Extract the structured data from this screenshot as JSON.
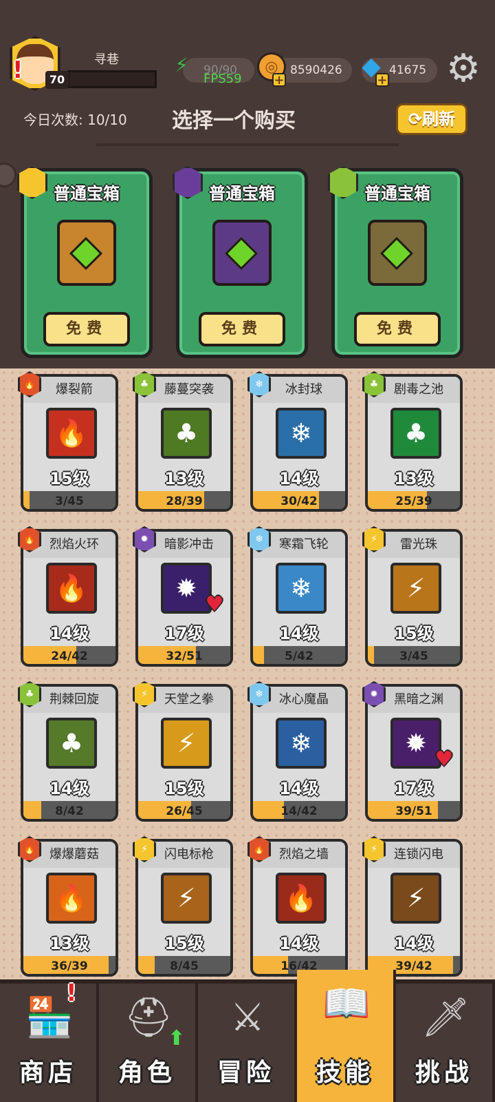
{
  "player": {
    "name": "寻巷",
    "level": "70"
  },
  "resources": {
    "energy": "90/90",
    "fps": "FPS59",
    "coins": "8590426",
    "gems": "41675"
  },
  "header": {
    "daily_count": "今日次数: 10/10",
    "title": "选择一个购买",
    "refresh_label": "刷新"
  },
  "chests": [
    {
      "title": "普通宝箱",
      "button": "免费",
      "element": "lightning",
      "elem_color": "#f6c52e",
      "body_color": "#c9842e"
    },
    {
      "title": "普通宝箱",
      "button": "免费",
      "element": "shadow",
      "elem_color": "#6a3d9a",
      "body_color": "#5d3a86"
    },
    {
      "title": "普通宝箱",
      "button": "免费",
      "element": "nature",
      "elem_color": "#8ac23a",
      "body_color": "#7b6a3a"
    }
  ],
  "skills": [
    {
      "name": "爆裂箭",
      "level": "15级",
      "progress": "3/45",
      "element": "fire",
      "color": "#e0522a",
      "icon_bg": "#c5301f"
    },
    {
      "name": "藤蔓突袭",
      "level": "13级",
      "progress": "28/39",
      "element": "nature",
      "color": "#8ac23a",
      "icon_bg": "#4d7a22"
    },
    {
      "name": "冰封球",
      "level": "14级",
      "progress": "30/42",
      "element": "ice",
      "color": "#7ec8f0",
      "icon_bg": "#2a6fa8"
    },
    {
      "name": "剧毒之池",
      "level": "13级",
      "progress": "25/39",
      "element": "nature",
      "color": "#8ac23a",
      "icon_bg": "#1f8a3a"
    },
    {
      "name": "烈焰火环",
      "level": "14级",
      "progress": "24/42",
      "element": "fire",
      "color": "#e0522a",
      "icon_bg": "#a82a1a"
    },
    {
      "name": "暗影冲击",
      "level": "17级",
      "progress": "32/51",
      "element": "shadow",
      "color": "#7a4fb0",
      "icon_bg": "#3a1f6a",
      "favorite": true
    },
    {
      "name": "寒霜飞轮",
      "level": "14级",
      "progress": "5/42",
      "element": "ice",
      "color": "#7ec8f0",
      "icon_bg": "#3a88c8"
    },
    {
      "name": "雷光珠",
      "level": "15级",
      "progress": "3/45",
      "element": "lightning",
      "color": "#f6c52e",
      "icon_bg": "#b8751a"
    },
    {
      "name": "荆棘回旋",
      "level": "14级",
      "progress": "8/42",
      "element": "nature",
      "color": "#8ac23a",
      "icon_bg": "#557a2a"
    },
    {
      "name": "天堂之拳",
      "level": "15级",
      "progress": "26/45",
      "element": "lightning",
      "color": "#f6c52e",
      "icon_bg": "#d89a1a"
    },
    {
      "name": "冰心魔晶",
      "level": "14级",
      "progress": "14/42",
      "element": "ice",
      "color": "#7ec8f0",
      "icon_bg": "#2a5fa0"
    },
    {
      "name": "黑暗之渊",
      "level": "17级",
      "progress": "39/51",
      "element": "shadow",
      "color": "#7a4fb0",
      "icon_bg": "#4a1f6a",
      "favorite": true
    },
    {
      "name": "爆爆蘑菇",
      "level": "13级",
      "progress": "36/39",
      "element": "fire",
      "color": "#e0522a",
      "icon_bg": "#d8641a"
    },
    {
      "name": "闪电标枪",
      "level": "15级",
      "progress": "8/45",
      "element": "lightning",
      "color": "#f6c52e",
      "icon_bg": "#a8641a"
    },
    {
      "name": "烈焰之墙",
      "level": "14级",
      "progress": "16/42",
      "element": "fire",
      "color": "#e0522a",
      "icon_bg": "#9a2a1a"
    },
    {
      "name": "连锁闪电",
      "level": "14级",
      "progress": "39/42",
      "element": "lightning",
      "color": "#f6c52e",
      "icon_bg": "#7a4a1a"
    }
  ],
  "nav": [
    {
      "label": "商店",
      "icon": "shop-icon",
      "alert": true
    },
    {
      "label": "角色",
      "icon": "helmet-icon",
      "upgrade": true
    },
    {
      "label": "冒险",
      "icon": "crossed-swords-icon"
    },
    {
      "label": "技能",
      "icon": "spellbook-icon",
      "active": true
    },
    {
      "label": "挑战",
      "icon": "sword-icon"
    }
  ]
}
